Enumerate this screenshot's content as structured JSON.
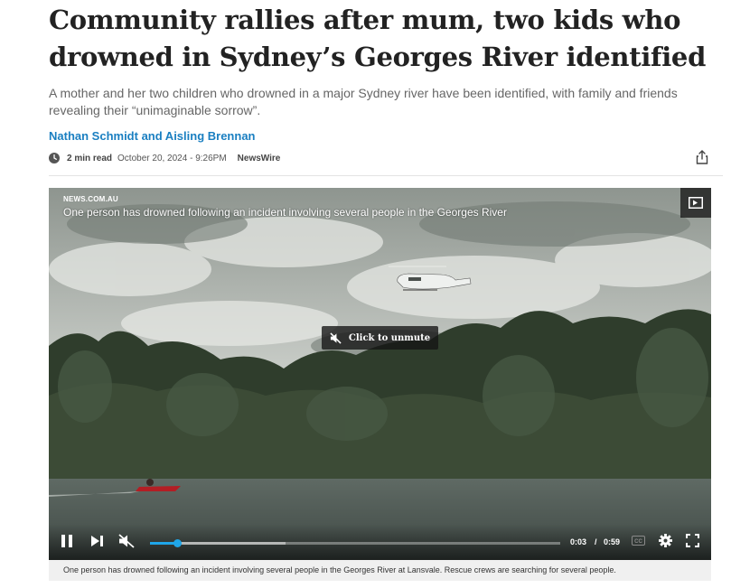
{
  "article": {
    "headline": "Community rallies after mum, two kids who drowned in Sydney’s Georges River identified",
    "standfirst": "A mother and her two children who drowned in a major Sydney river have been identified, with family and friends revealing their “unimaginable sorrow”.",
    "byline": "Nathan Schmidt and Aisling Brennan",
    "read_time": "2 min read",
    "date": "October 20, 2024 - 9:26PM",
    "source": "NewsWire",
    "icons": {
      "clock": "clock-icon",
      "share": "share-icon"
    }
  },
  "video": {
    "source_label": "NEWS.COM.AU",
    "title": "One person has drowned following an incident involving several people in the Georges River",
    "unmute_label": "Click to unmute",
    "current_time": "0:03",
    "time_separator": "/",
    "duration": "0:59",
    "progress_fraction": 0.065,
    "buffered_fraction": 0.33,
    "accent_color": "#1fa6e8",
    "icons": {
      "pip": "picture-in-picture-icon",
      "pause": "pause-icon",
      "next": "skip-next-icon",
      "mute": "muted-speaker-icon",
      "cc": "closed-captions-icon",
      "settings": "gear-icon",
      "fullscreen": "fullscreen-icon"
    },
    "caption": "One person has drowned following an incident involving several people in the Georges River at Lansvale. Rescue crews are searching for several people."
  }
}
